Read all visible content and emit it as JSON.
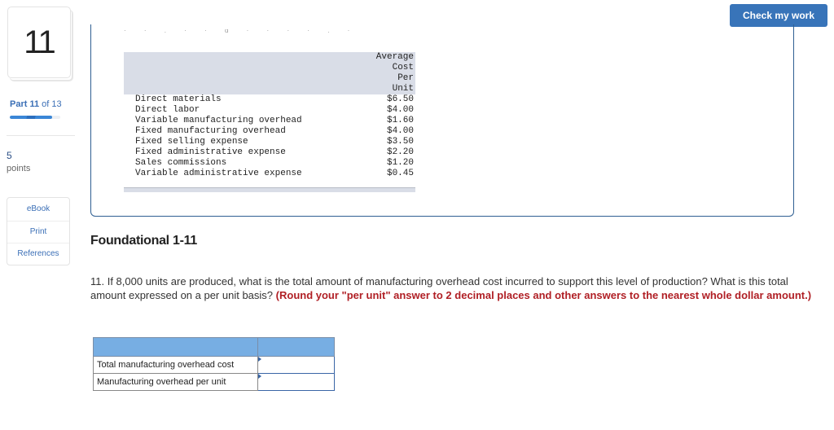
{
  "sidebar": {
    "question_number": "11",
    "part_prefix": "Part",
    "part_current": "11",
    "part_of": "of 13",
    "progress_fraction": 0.846,
    "points_value": "5",
    "points_label": "points",
    "tools": [
      {
        "label": "eBook",
        "icon": "ebook"
      },
      {
        "label": "Print",
        "icon": "print"
      },
      {
        "label": "References",
        "icon": "references"
      }
    ]
  },
  "header": {
    "check_button_label": "Check my work"
  },
  "cost_table": {
    "header": "Average Cost Per Unit",
    "header_lines": [
      "Average",
      "Cost",
      "Per",
      "Unit"
    ],
    "rows": [
      {
        "item": "Direct materials",
        "value": "$6.50"
      },
      {
        "item": "Direct labor",
        "value": "$4.00"
      },
      {
        "item": "Variable manufacturing overhead",
        "value": "$1.60"
      },
      {
        "item": "Fixed manufacturing overhead",
        "value": "$4.00"
      },
      {
        "item": "Fixed selling expense",
        "value": "$3.50"
      },
      {
        "item": "Fixed administrative expense",
        "value": "$2.20"
      },
      {
        "item": "Sales commissions",
        "value": "$1.20"
      },
      {
        "item": "Variable administrative expense",
        "value": "$0.45"
      }
    ]
  },
  "question": {
    "title": "Foundational 1-11",
    "text": "11. If 8,000 units are produced, what is the total amount of manufacturing overhead cost incurred to support this level of production? What is this total amount expressed on a per unit basis?",
    "hint": "(Round your \"per unit\" answer to 2 decimal places and other answers to the nearest whole dollar amount.)"
  },
  "answer_table": {
    "rows": [
      {
        "label": "Total manufacturing overhead cost",
        "value": ""
      },
      {
        "label": "Manufacturing overhead per unit",
        "value": ""
      }
    ]
  },
  "colors": {
    "accent": "#3874b9",
    "hint_red": "#b01f25",
    "answer_header": "#77aee3",
    "table_header": "#d9dde7"
  }
}
